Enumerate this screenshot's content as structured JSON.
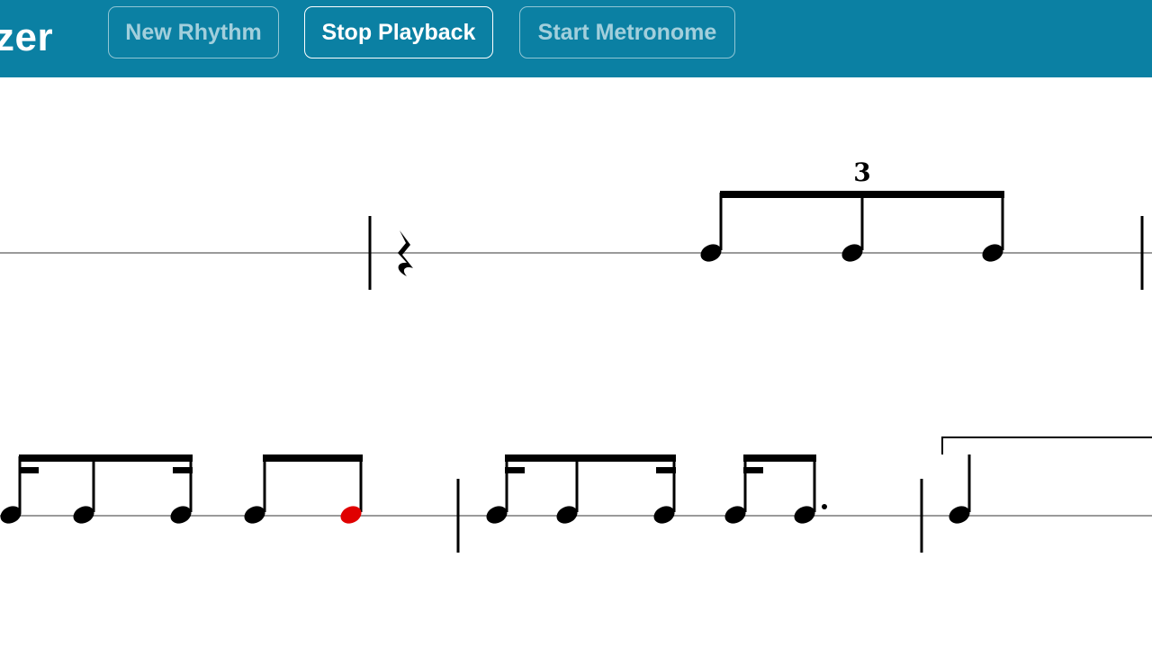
{
  "header": {
    "app_title": "zer",
    "buttons": {
      "new_rhythm": "New Rhythm",
      "stop_playback": "Stop Playback",
      "start_metronome": "Start Metronome"
    }
  },
  "score": {
    "tuplet_number": "3",
    "colors": {
      "header_bg": "#0b80a3",
      "ink": "#000000",
      "staff_line": "#9a9a9a",
      "playhead_note": "#e00000"
    },
    "icons": [
      "quarter-rest-icon",
      "note-head-icon",
      "augmentation-dot-icon",
      "bar-line-icon"
    ]
  }
}
